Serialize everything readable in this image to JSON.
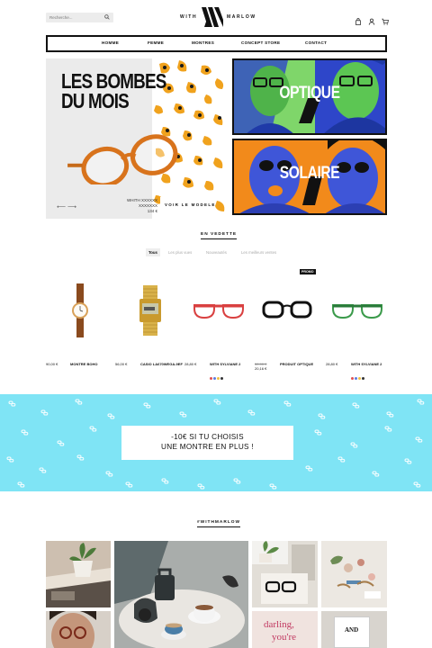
{
  "header": {
    "search_placeholder": "Recherche...",
    "logo_left": "WITH",
    "logo_right": "MARLOW",
    "icons": [
      "search-icon",
      "bag-icon",
      "user-icon",
      "cart-icon"
    ]
  },
  "nav": {
    "items": [
      "HOMME",
      "FEMME",
      "MONTRES",
      "CONCEPT STORE",
      "CONTACT"
    ]
  },
  "hero": {
    "title_line1": "LES BOMBES",
    "title_line2": "DU MOIS",
    "product_name": "WHITH XXXXXX",
    "product_sub": "XXXXXXX",
    "product_price": "134 €",
    "cta": "VOIR LE MODELE",
    "arrows": "⟵ ⟶",
    "tile_optique": "OPTIQUE",
    "tile_solaire": "SOLAIRE",
    "colors": {
      "leopard": "#f0a21d",
      "optique_bg": "#2e46c9",
      "optique_accent": "#7fd66a",
      "solaire_bg": "#f28a1b",
      "solaire_accent": "#3f56d8"
    }
  },
  "featured": {
    "title": "EN VEDETTE",
    "filters": [
      "Tous",
      "Les plus vues",
      "Nouveautés",
      "Les meilleurs ventes"
    ],
    "active_filter": "Tous",
    "badge": "PROMO",
    "products": [
      {
        "price": "90,00 €",
        "name": "MONTRE BOHO"
      },
      {
        "price": "56,00 €",
        "name": "CASIO LA670WEGA-9EF"
      },
      {
        "price": "28,80 €",
        "name": "WITH SYLVIANE 2"
      },
      {
        "price_old": "30,90 €",
        "price": "20,16 €",
        "name": "PRODUIT OPTIQUE"
      },
      {
        "price": "28,80 €",
        "name": "WITH SYLVIANE 2"
      }
    ],
    "swatches": [
      "#e05050",
      "#5b7be0",
      "#f0c040",
      "#333333"
    ]
  },
  "promo": {
    "line1": "-10€ SI TU CHOISIS",
    "line2": "UNE MONTRE EN PLUS !",
    "bg_color": "#7fe4f5"
  },
  "instagram": {
    "tag": "#WITHMARLOW",
    "card_text_1": "darling,",
    "card_text_2": "you're",
    "book_text": "AND"
  }
}
